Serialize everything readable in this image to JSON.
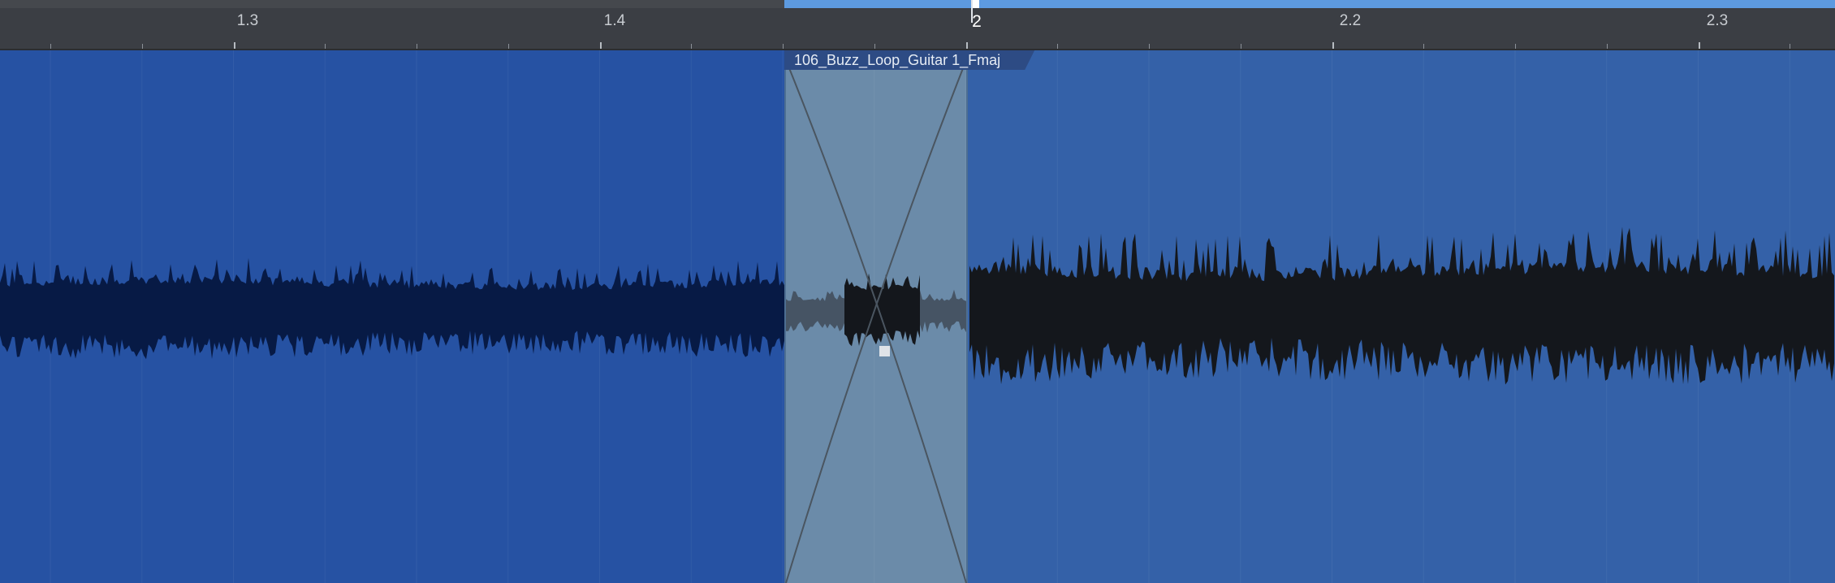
{
  "ruler": {
    "labels": [
      {
        "text": "1.3"
      },
      {
        "text": "1.4"
      },
      {
        "text": "2"
      },
      {
        "text": "2.2"
      },
      {
        "text": "2.3"
      }
    ]
  },
  "clip": {
    "name": "106_Buzz_Loop_Guitar 1_Fmaj"
  },
  "colors": {
    "clip_left": "#2652a3",
    "clip_right": "#3461a8",
    "crossfade": "#6b8ba9",
    "waveform_left": "#071a45",
    "waveform_right": "#14171c",
    "ruler_bg": "#3b3e44",
    "selection": "#5d9ae0"
  }
}
